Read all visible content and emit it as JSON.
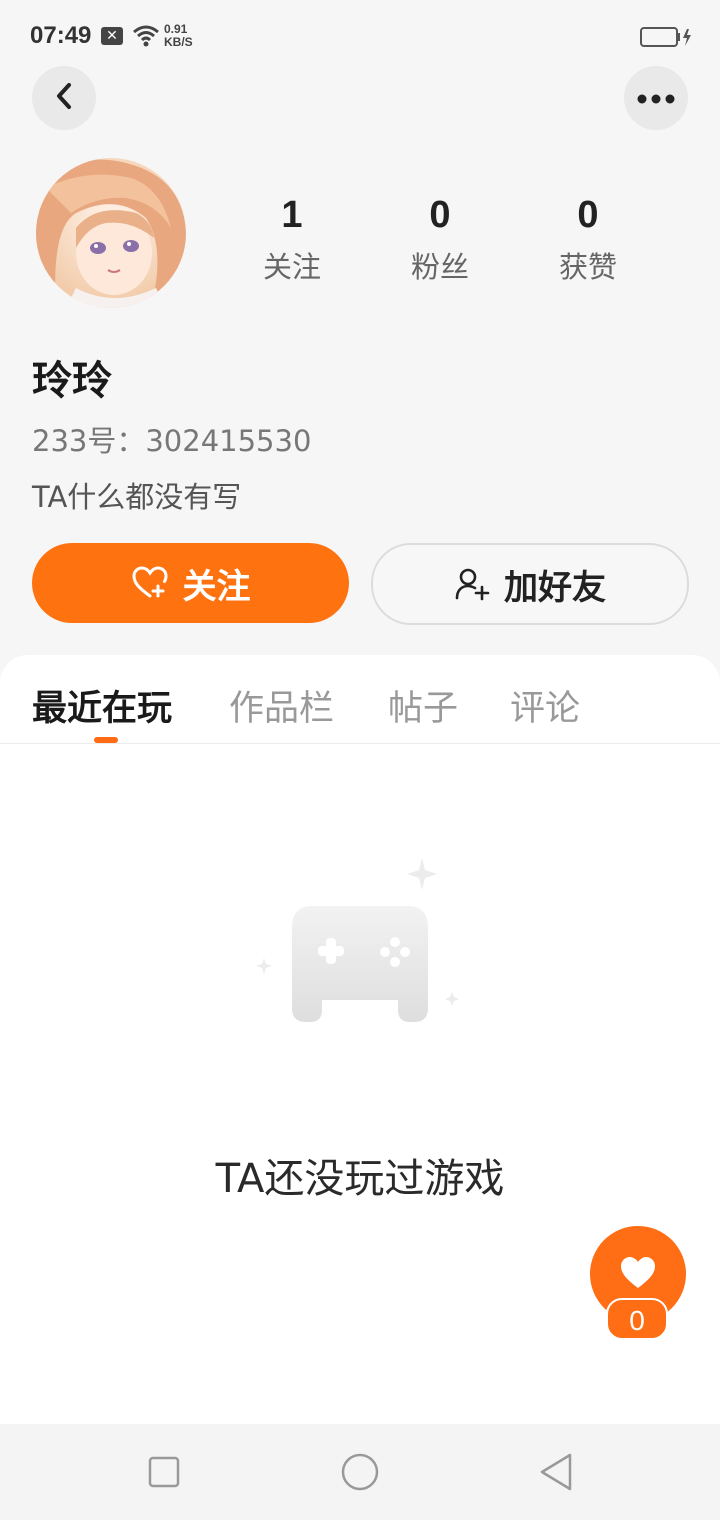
{
  "status_bar": {
    "time": "07:49",
    "notification_badge": "✕",
    "net_speed_value": "0.91",
    "net_speed_unit": "KB/S",
    "icons": [
      "wifi-icon",
      "battery-icon"
    ]
  },
  "header": {
    "back_icon": "chevron-left-icon",
    "more_icon": "more-horizontal-icon"
  },
  "profile": {
    "name": "玲玲",
    "id_line": "233号：302415530",
    "bio": "TA什么都没有写",
    "stats": [
      {
        "value": "1",
        "label": "关注"
      },
      {
        "value": "0",
        "label": "粉丝"
      },
      {
        "value": "0",
        "label": "获赞"
      }
    ]
  },
  "actions": {
    "follow_label": "关注",
    "add_friend_label": "加好友",
    "accent_color": "#ff7210"
  },
  "tabs": [
    {
      "label": "最近在玩",
      "active": true
    },
    {
      "label": "作品栏",
      "active": false
    },
    {
      "label": "帖子",
      "active": false
    },
    {
      "label": "评论",
      "active": false
    }
  ],
  "empty_state": {
    "message": "TA还没玩过游戏",
    "icon": "gamepad-icon"
  },
  "like_fab": {
    "count": "0",
    "icon": "heart-icon"
  },
  "nav_bar": {
    "icons": [
      "recents-square-icon",
      "home-circle-icon",
      "back-triangle-icon"
    ]
  }
}
